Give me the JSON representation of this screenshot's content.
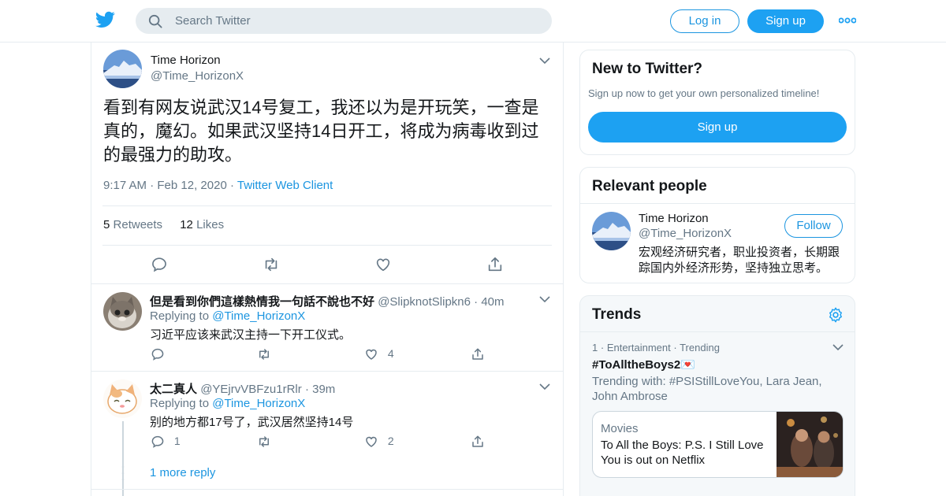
{
  "colors": {
    "brand": "#1da1f2",
    "link": "#1b95e0",
    "muted": "#657786",
    "border": "#e6ecf0",
    "like_pink": "#e0245e"
  },
  "header": {
    "search_placeholder": "Search Twitter",
    "login_label": "Log in",
    "signup_label": "Sign up"
  },
  "tweet": {
    "name": "Time Horizon",
    "handle": "@Time_HorizonX",
    "text": "看到有网友说武汉14号复工，我还以为是开玩笑，一查是真的，魔幻。如果武汉坚持14日开工，将成为病毒收到过的最强力的助攻。",
    "time": "9:17 AM",
    "date": "Feb 12, 2020",
    "source": "Twitter Web Client",
    "retweets": "5",
    "retweets_label": "Retweets",
    "likes": "12",
    "likes_label": "Likes"
  },
  "replies": [
    {
      "name": "但是看到你們這樣熱情我一句話不說也不好",
      "handle": "@SlipknotSlipkn6",
      "time": "40m",
      "replying_label": "Replying to",
      "replying_to": "@Time_HorizonX",
      "text": "习近平应该来武汉主持一下开工仪式。",
      "reply_count": "",
      "retweet_count": "",
      "like_count": "4"
    },
    {
      "name": "太二真人",
      "handle": "@YEjrvVBFzu1rRlr",
      "time": "39m",
      "replying_label": "Replying to",
      "replying_to": "@Time_HorizonX",
      "text": "别的地方都17号了，武汉居然坚持14号",
      "reply_count": "1",
      "retweet_count": "",
      "like_count": "2"
    }
  ],
  "more_replies": "1 more reply",
  "sidebar": {
    "new_to_twitter": {
      "title": "New to Twitter?",
      "subtitle": "Sign up now to get your own personalized timeline!",
      "button": "Sign up"
    },
    "relevant_people": {
      "title": "Relevant people",
      "name": "Time Horizon",
      "handle": "@Time_HorizonX",
      "follow": "Follow",
      "bio": "宏观经济研究者，职业投资者，长期跟踪国内外经济形势，坚持独立思考。"
    },
    "trends": {
      "title": "Trends",
      "rank": "1",
      "category": "Entertainment",
      "status": "Trending",
      "hashtag": "#ToAlltheBoys2💌",
      "trending_with": "Trending with: #PSIStillLoveYou, Lara Jean, John Ambrose",
      "card_category": "Movies",
      "card_text": "To All the Boys: P.S. I Still Love You is out on Netflix"
    }
  }
}
